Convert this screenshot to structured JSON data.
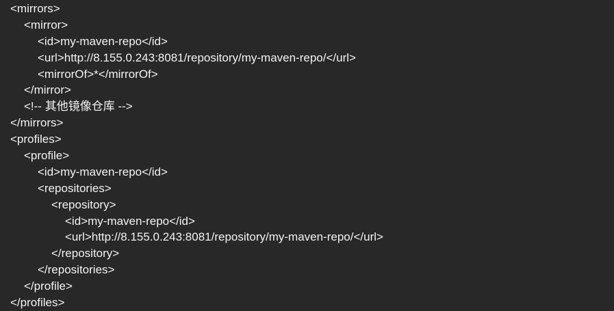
{
  "editor": {
    "background": "#282828",
    "text_color": "#f2f2f2",
    "lines": [
      {
        "indent": 0,
        "text": "<mirrors>"
      },
      {
        "indent": 1,
        "text": "<mirror>"
      },
      {
        "indent": 2,
        "text": "<id>my-maven-repo</id>"
      },
      {
        "indent": 2,
        "text": "<url>http://8.155.0.243:8081/repository/my-maven-repo/</url>"
      },
      {
        "indent": 2,
        "text": "<mirrorOf>*</mirrorOf>"
      },
      {
        "indent": 1,
        "text": "</mirror>"
      },
      {
        "indent": 1,
        "text": "<!-- 其他镜像仓库 -->"
      },
      {
        "indent": 0,
        "text": "</mirrors>"
      },
      {
        "indent": 0,
        "text": "<profiles>"
      },
      {
        "indent": 1,
        "text": "<profile>"
      },
      {
        "indent": 2,
        "text": "<id>my-maven-repo</id>"
      },
      {
        "indent": 2,
        "text": "<repositories>"
      },
      {
        "indent": 3,
        "text": "<repository>"
      },
      {
        "indent": 4,
        "text": "<id>my-maven-repo</id>"
      },
      {
        "indent": 4,
        "text": "<url>http://8.155.0.243:8081/repository/my-maven-repo/</url>"
      },
      {
        "indent": 3,
        "text": "</repository>"
      },
      {
        "indent": 2,
        "text": "</repositories>"
      },
      {
        "indent": 1,
        "text": "</profile>"
      },
      {
        "indent": 0,
        "text": "</profiles>"
      }
    ]
  }
}
